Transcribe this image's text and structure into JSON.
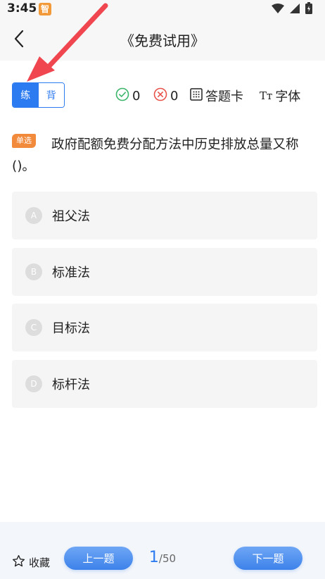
{
  "status_bar": {
    "time": "3:45",
    "app_badge": "智",
    "icons": [
      "wifi-icon",
      "signal-icon",
      "battery-icon"
    ]
  },
  "header": {
    "title": "《免费试用》",
    "back_icon": "chevron-left-icon"
  },
  "mode_toggle": {
    "practice_label": "练",
    "recite_label": "背",
    "active": "practice"
  },
  "toolbar": {
    "correct_count": "0",
    "wrong_count": "0",
    "answer_card_label": "答题卡",
    "font_label": "字体",
    "font_icon_text": "Tт"
  },
  "question": {
    "type_tag": "单选",
    "text": "政府配额免费分配方法中历史排放总量又称()。",
    "options": [
      {
        "letter": "A",
        "text": "祖父法"
      },
      {
        "letter": "B",
        "text": "标准法"
      },
      {
        "letter": "C",
        "text": "目标法"
      },
      {
        "letter": "D",
        "text": "标杆法"
      }
    ]
  },
  "footer": {
    "favorite_label": "收藏",
    "prev_label": "上一题",
    "next_label": "下一题",
    "current_page": "1",
    "total_pages": "/50"
  },
  "colors": {
    "accent": "#2d7bf0",
    "tag": "#f28a3c",
    "correct": "#3bb56a",
    "wrong": "#e8524a",
    "annotation_arrow": "#f0464f"
  }
}
